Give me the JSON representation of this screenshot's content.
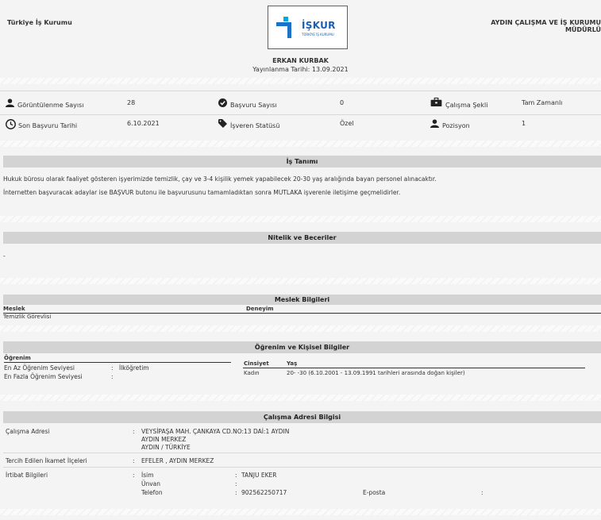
{
  "header": {
    "org_left": "Türkiye İş Kurumu",
    "logo_text": "İŞKUR",
    "logo_sub": "TÜRKİYE İŞ KURUMU",
    "org_right_line1": "AYDIN ÇALIŞMA VE İŞ KURUMU",
    "org_right_line2": "MÜDÜRLÜ",
    "employer": "ERKAN KURBAK",
    "publish_label": "Yayınlanma Tarihi:",
    "publish_date": "13.09.2021"
  },
  "stats": {
    "views_label": "Görüntülenme Sayısı",
    "views_value": "28",
    "applications_label": "Başvuru Sayısı",
    "applications_value": "0",
    "work_type_label": "Çalışma Şekli",
    "work_type_value": "Tam Zamanlı",
    "deadline_label": "Son Başvuru Tarihi",
    "deadline_value": "6.10.2021",
    "employer_status_label": "İşveren Statüsü",
    "employer_status_value": "Özel",
    "position_label": "Pozisyon",
    "position_value": "1"
  },
  "job_description": {
    "title": "İş Tanımı",
    "line1": "Hukuk bürosu olarak faaliyet gösteren işyerimizde temizlik, çay ve 3-4 kişilik yemek yapabilecek 20-30 yaş aralığında bayan personel alınacaktır.",
    "line2": "İnternetten başvuracak adaylar ise BAŞVUR butonu ile başvurusunu tamamladıktan sonra MUTLAKA işverenle iletişime geçmelidirler."
  },
  "skills": {
    "title": "Nitelik ve Beceriler",
    "value": "-"
  },
  "profession": {
    "title": "Meslek Bilgileri",
    "col_profession": "Meslek",
    "col_experience": "Deneyim",
    "profession_value": "Temizlik Görevlisi"
  },
  "education": {
    "title": "Öğrenim ve Kişisel Bilgiler",
    "edu_header": "Öğrenim",
    "min_label": "En Az Öğrenim Seviyesi",
    "min_value": "İlköğretim",
    "max_label": "En Fazla Öğrenim Seviyesi",
    "max_value": "",
    "gender_header": "Cinsiyet",
    "age_header": "Yaş",
    "gender_value": "Kadın",
    "age_value": "20- -30 (6.10.2001 - 13.09.1991 tarihleri arasında doğan kişiler)"
  },
  "address": {
    "title": "Çalışma Adresi Bilgisi",
    "work_address_label": "Çalışma Adresi",
    "work_address_line1": "VEYSİPAŞA MAH. ÇANKAYA CD.NO:13 DAİ:1 AYDIN",
    "work_address_line2": "AYDIN MERKEZ",
    "work_address_line3": "AYDIN / TÜRKİYE",
    "residence_label": "Tercih Edilen İkamet İlçeleri",
    "residence_value": "EFELER ,  AYDIN MERKEZ",
    "contact_label": "İrtibat Bilgileri",
    "name_label": "İsim",
    "name_value": "TANJU EKER",
    "title_label": "Ünvan",
    "title_value": "",
    "phone_label": "Telefon",
    "phone_value": "902562250717",
    "email_label": "E-posta",
    "email_value": ""
  },
  "colors": {
    "logo_blue": "#1a73c8",
    "logo_cyan": "#00a9e0",
    "section_bar": "#d3d3d3"
  }
}
